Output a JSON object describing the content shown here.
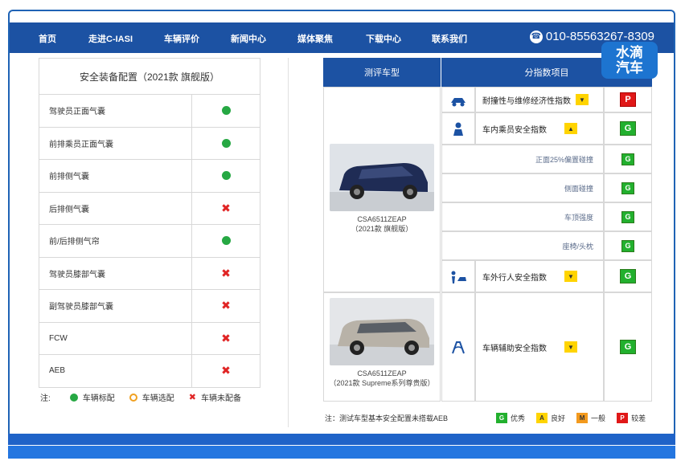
{
  "nav": {
    "items": [
      "首页",
      "走进C-IASI",
      "车辆评价",
      "新闻中心",
      "媒体聚焦",
      "下载中心",
      "联系我们"
    ],
    "phone": "010-85563267-8309",
    "phone_icon": "phone-icon"
  },
  "logo": {
    "line1": "水滴",
    "line2": "汽车"
  },
  "left": {
    "title": "安全装备配置（2021款 旗舰版）",
    "rows": [
      {
        "name": "驾驶员正面气囊",
        "status": "standard"
      },
      {
        "name": "前排乘员正面气囊",
        "status": "standard"
      },
      {
        "name": "前排侧气囊",
        "status": "standard"
      },
      {
        "name": "后排侧气囊",
        "status": "none"
      },
      {
        "name": "前/后排侧气帘",
        "status": "standard"
      },
      {
        "name": "驾驶员膝部气囊",
        "status": "none"
      },
      {
        "name": "副驾驶员膝部气囊",
        "status": "none"
      },
      {
        "name": "FCW",
        "status": "none"
      },
      {
        "name": "AEB",
        "status": "none"
      }
    ],
    "legend": {
      "prefix": "注:",
      "standard": "车辆标配",
      "optional": "车辆选配",
      "none": "车辆未配备"
    }
  },
  "right": {
    "header_model": "测评车型",
    "header_index": "分指数项目",
    "car1": {
      "model": "CSA6511ZEAP",
      "trim": "（2021款 旗舰版）"
    },
    "car2": {
      "model": "CSA6511ZEAP",
      "trim": "（2021款 Supreme系列尊贵版）"
    },
    "indexes": [
      {
        "label": "耐撞性与维修经济性指数",
        "grade": "P"
      },
      {
        "label": "车内乘员安全指数",
        "grade": "G"
      },
      {
        "label": "正面25%偏置碰撞",
        "grade": "G"
      },
      {
        "label": "侧面碰撞",
        "grade": "G"
      },
      {
        "label": "车顶强度",
        "grade": "G"
      },
      {
        "label": "座椅/头枕",
        "grade": "G"
      },
      {
        "label": "车外行人安全指数",
        "grade": "G"
      },
      {
        "label": "车辆辅助安全指数",
        "grade": "G"
      }
    ],
    "legend": {
      "note": "注：测试车型基本安全配置未搭载AEB",
      "items": [
        {
          "letter": "G",
          "label": "优秀",
          "color": "#22b02e"
        },
        {
          "letter": "A",
          "label": "良好",
          "color": "#ffd400"
        },
        {
          "letter": "M",
          "label": "一般",
          "color": "#f39a1e"
        },
        {
          "letter": "P",
          "label": "较差",
          "color": "#e01818"
        }
      ]
    }
  }
}
